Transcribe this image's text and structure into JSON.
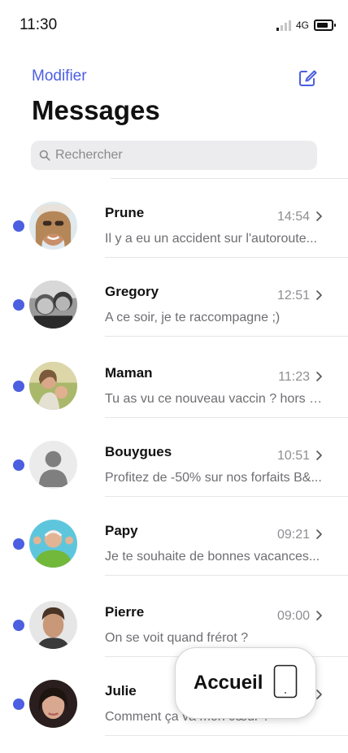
{
  "status_bar": {
    "time": "11:30",
    "network": "4G"
  },
  "header": {
    "edit_label": "Modifier",
    "title": "Messages"
  },
  "search": {
    "placeholder": "Rechercher",
    "value": ""
  },
  "conversations": [
    {
      "name": "Prune",
      "time": "14:54",
      "preview": "Il y a eu un accident sur l'autoroute...",
      "unread": true,
      "avatar": "photo-woman-sunglasses"
    },
    {
      "name": "Gregory",
      "time": "12:51",
      "preview": "A ce soir, je te raccompagne ;)",
      "unread": true,
      "avatar": "photo-bw-friends"
    },
    {
      "name": "Maman",
      "time": "11:23",
      "preview": "Tu as vu ce nouveau vaccin ? hors d...",
      "unread": true,
      "avatar": "photo-mother-child"
    },
    {
      "name": "Bouygues",
      "time": "10:51",
      "preview": "Profitez de -50% sur nos forfaits B&...",
      "unread": true,
      "avatar": "default-person-icon"
    },
    {
      "name": "Papy",
      "time": "09:21",
      "preview": "Je te souhaite de bonnes vacances...",
      "unread": true,
      "avatar": "photo-old-man"
    },
    {
      "name": "Pierre",
      "time": "09:00",
      "preview": "On se voit quand frérot ?",
      "unread": true,
      "avatar": "photo-young-man"
    },
    {
      "name": "Julie",
      "time": "",
      "preview": "Comment ça va mon cœur ?",
      "unread": true,
      "avatar": "photo-young-woman"
    }
  ],
  "floating_button": {
    "label": "Accueil",
    "icon": "phone-icon"
  },
  "colors": {
    "accent": "#4b5fe0",
    "unread_dot": "#4b5fe0",
    "secondary_text": "#8e8e93"
  }
}
